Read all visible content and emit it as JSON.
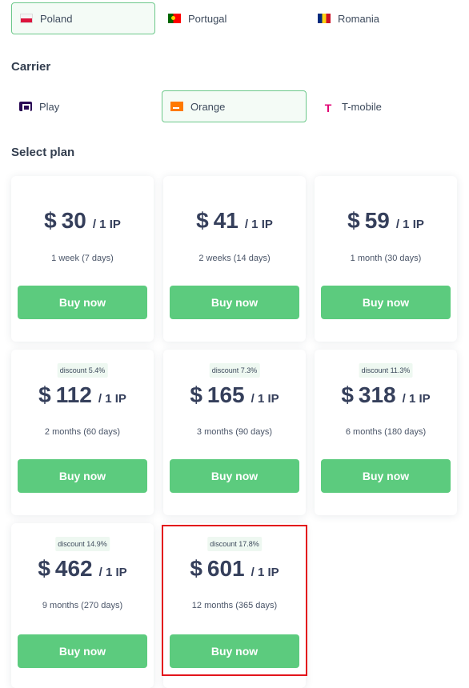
{
  "countries": [
    {
      "label": "Poland",
      "flag": "flag-pl",
      "selected": true
    },
    {
      "label": "Portugal",
      "flag": "flag-pt",
      "selected": false
    },
    {
      "label": "Romania",
      "flag": "flag-ro",
      "selected": false
    }
  ],
  "carrier": {
    "heading": "Carrier",
    "items": [
      {
        "label": "Play",
        "icon": "play-logo-icon",
        "selected": false
      },
      {
        "label": "Orange",
        "icon": "orange-logo-icon",
        "selected": true
      },
      {
        "label": "T-mobile",
        "icon": "t-mobile-logo-icon",
        "selected": false
      }
    ]
  },
  "plans": {
    "heading": "Select plan",
    "buy_label": "Buy now",
    "currency": "$",
    "unit": "/ 1 IP",
    "items": [
      {
        "price": "30",
        "duration": "1 week (7 days)",
        "discount": ""
      },
      {
        "price": "41",
        "duration": "2 weeks (14 days)",
        "discount": ""
      },
      {
        "price": "59",
        "duration": "1 month (30 days)",
        "discount": ""
      },
      {
        "price": "112",
        "duration": "2 months (60 days)",
        "discount": "discount 5.4%"
      },
      {
        "price": "165",
        "duration": "3 months (90 days)",
        "discount": "discount 7.3%"
      },
      {
        "price": "318",
        "duration": "6 months (180 days)",
        "discount": "discount 11.3%"
      },
      {
        "price": "462",
        "duration": "9 months (270 days)",
        "discount": "discount 14.9%"
      },
      {
        "price": "601",
        "duration": "12 months (365 days)",
        "discount": "discount 17.8%",
        "highlighted": true
      }
    ]
  },
  "colors": {
    "accent": "#5ccb7e",
    "selected_border": "#6cc88a",
    "highlight_border": "#e3141b",
    "price_text": "#353f5b"
  }
}
